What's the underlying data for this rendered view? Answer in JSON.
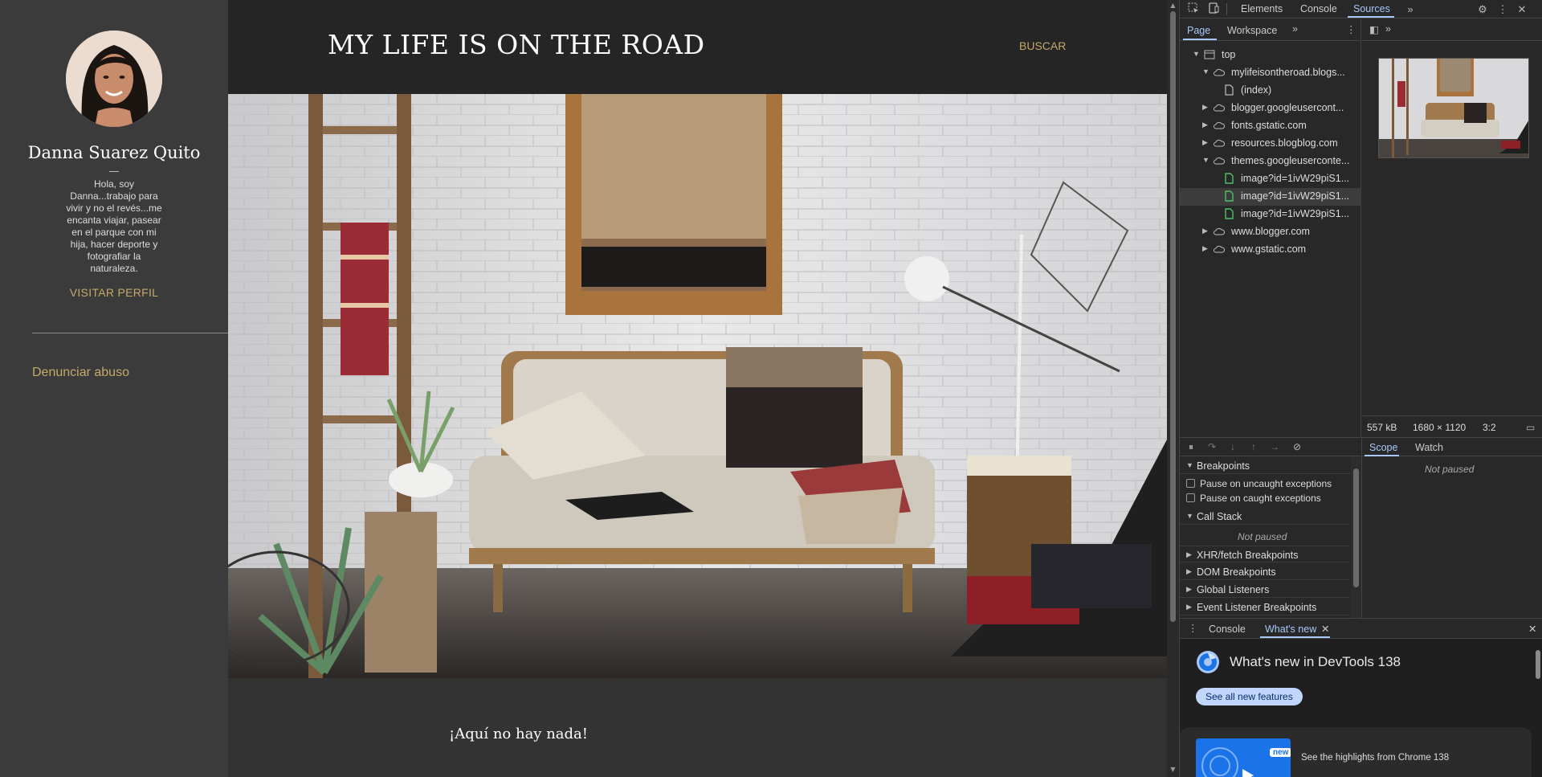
{
  "blog": {
    "sidebar": {
      "profile_name": "Danna Suarez Quito",
      "bio_lines": [
        "Hola, soy",
        "Danna...trabajo para",
        "vivir y no el revés...me",
        "encanta viajar, pasear",
        "en el parque con mi",
        "hija, hacer deporte y",
        "fotografiar la",
        "naturaleza."
      ],
      "visit_profile": "VISITAR PERFIL",
      "report_abuse": "Denunciar abuso"
    },
    "header": {
      "title": "MY LIFE IS ON THE ROAD",
      "search": "BUSCAR"
    },
    "empty_message": "¡Aquí no hay nada!",
    "colors": {
      "accent": "#c6a969",
      "background": "#333333",
      "sidebar": "#3b3b3b",
      "header": "#252525"
    }
  },
  "devtools": {
    "toolbar": {
      "tabs": [
        "Elements",
        "Console",
        "Sources"
      ],
      "active_tab": "Sources",
      "icons": [
        "inspect-icon",
        "device-toolbar-icon",
        "more-tabs-icon",
        "settings-icon",
        "kebab-menu-icon",
        "close-icon"
      ]
    },
    "navigator": {
      "tabs": [
        "Page",
        "Workspace"
      ],
      "active_tab": "Page",
      "tree": [
        {
          "label": "top",
          "type": "frame",
          "expanded": true
        },
        {
          "label": "mylifeisontheroad.blogs...",
          "type": "domain",
          "expanded": true
        },
        {
          "label": "(index)",
          "type": "file"
        },
        {
          "label": "blogger.googleusercont...",
          "type": "domain",
          "expanded": false
        },
        {
          "label": "fonts.gstatic.com",
          "type": "domain",
          "expanded": false
        },
        {
          "label": "resources.blogblog.com",
          "type": "domain",
          "expanded": false
        },
        {
          "label": "themes.googleuserconte...",
          "type": "domain",
          "expanded": true
        },
        {
          "label": "image?id=1ivW29piS1...",
          "type": "image"
        },
        {
          "label": "image?id=1ivW29piS1...",
          "type": "image",
          "selected": true
        },
        {
          "label": "image?id=1ivW29piS1...",
          "type": "image"
        },
        {
          "label": "www.blogger.com",
          "type": "domain",
          "expanded": false
        },
        {
          "label": "www.gstatic.com",
          "type": "domain",
          "expanded": false
        }
      ]
    },
    "preview": {
      "size": "557 kB",
      "dimensions": "1680 × 1120",
      "ratio": "3:2"
    },
    "debugger": {
      "sidebar_tabs": [
        "Scope",
        "Watch"
      ],
      "active_sidebar_tab": "Scope",
      "scope_status": "Not paused",
      "breakpoints_header": "Breakpoints",
      "pause_uncaught": "Pause on uncaught exceptions",
      "pause_caught": "Pause on caught exceptions",
      "call_stack_header": "Call Stack",
      "call_stack_status": "Not paused",
      "sections": [
        "XHR/fetch Breakpoints",
        "DOM Breakpoints",
        "Global Listeners",
        "Event Listener Breakpoints"
      ]
    },
    "drawer": {
      "tabs": [
        "Console",
        "What's new"
      ],
      "active_tab": "What's new",
      "whats_new_title": "What's new in DevTools 138",
      "see_all_button": "See all new features",
      "badge": "new",
      "card_text": "See the highlights from Chrome 138"
    },
    "colors": {
      "accent": "#a8c7fa",
      "panel": "#282828",
      "border": "#444444"
    }
  }
}
